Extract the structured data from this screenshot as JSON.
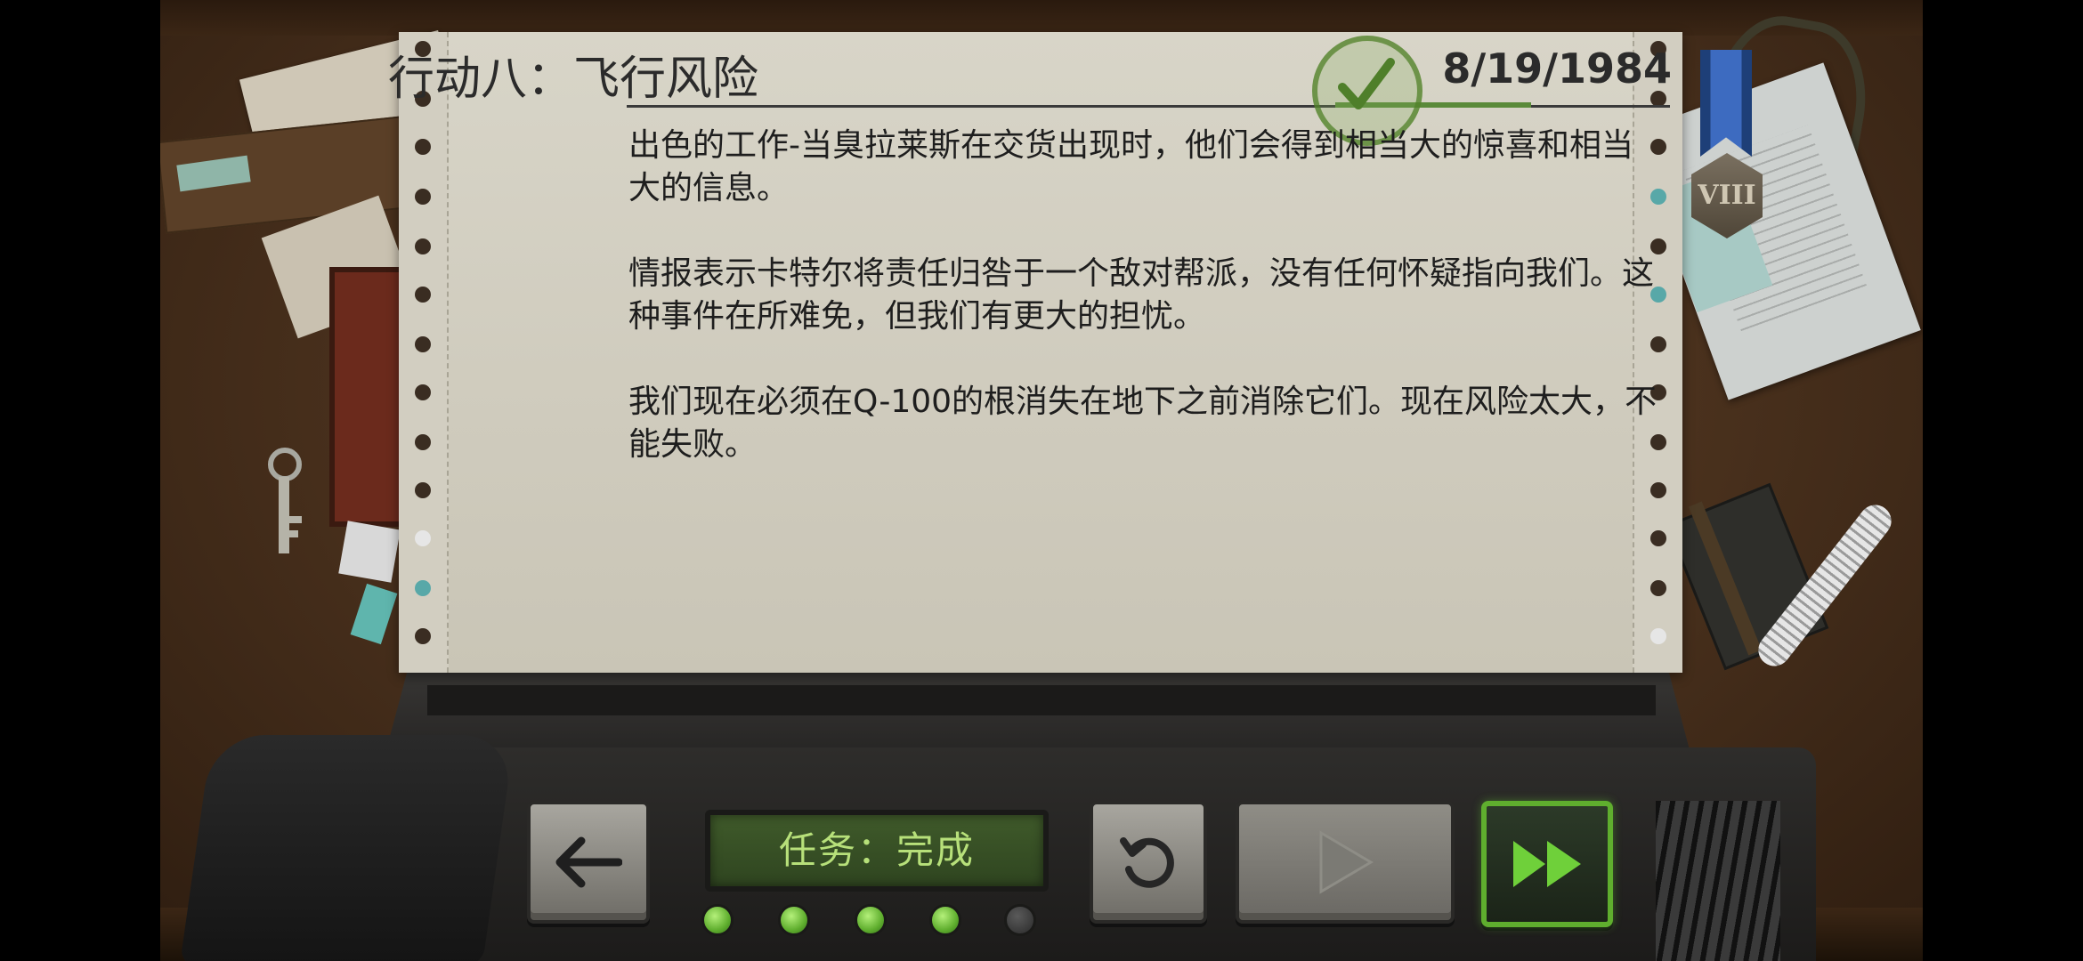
{
  "mission": {
    "title": "行动八：飞行风险",
    "date": "8/19/1984",
    "completed": true,
    "paragraphs": [
      "出色的工作-当臭拉莱斯在交货出现时，他们会得到相当大的惊喜和相当大的信息。",
      "情报表示卡特尔将责任归咎于一个敌对帮派，没有任何怀疑指向我们。这种事件在所难免，但我们有更大的担忧。",
      "我们现在必须在Q-100的根消失在地下之前消除它们。现在风险太大，不能失败。"
    ],
    "medal_rank": "VIII"
  },
  "controls": {
    "status_text": "任务：完成",
    "progress_leds": [
      true,
      true,
      true,
      true,
      false
    ]
  },
  "colors": {
    "paper": "#d3cfc2",
    "text": "#1e1e1e",
    "display_text": "#b7e07a",
    "accent_green": "#5fae2e",
    "medal_ribbon": "#3d6bc0"
  },
  "icons": {
    "back": "arrow-left-icon",
    "restart": "restart-icon",
    "play": "play-icon",
    "fast_forward": "fast-forward-icon",
    "stamp": "checkmark-icon"
  }
}
